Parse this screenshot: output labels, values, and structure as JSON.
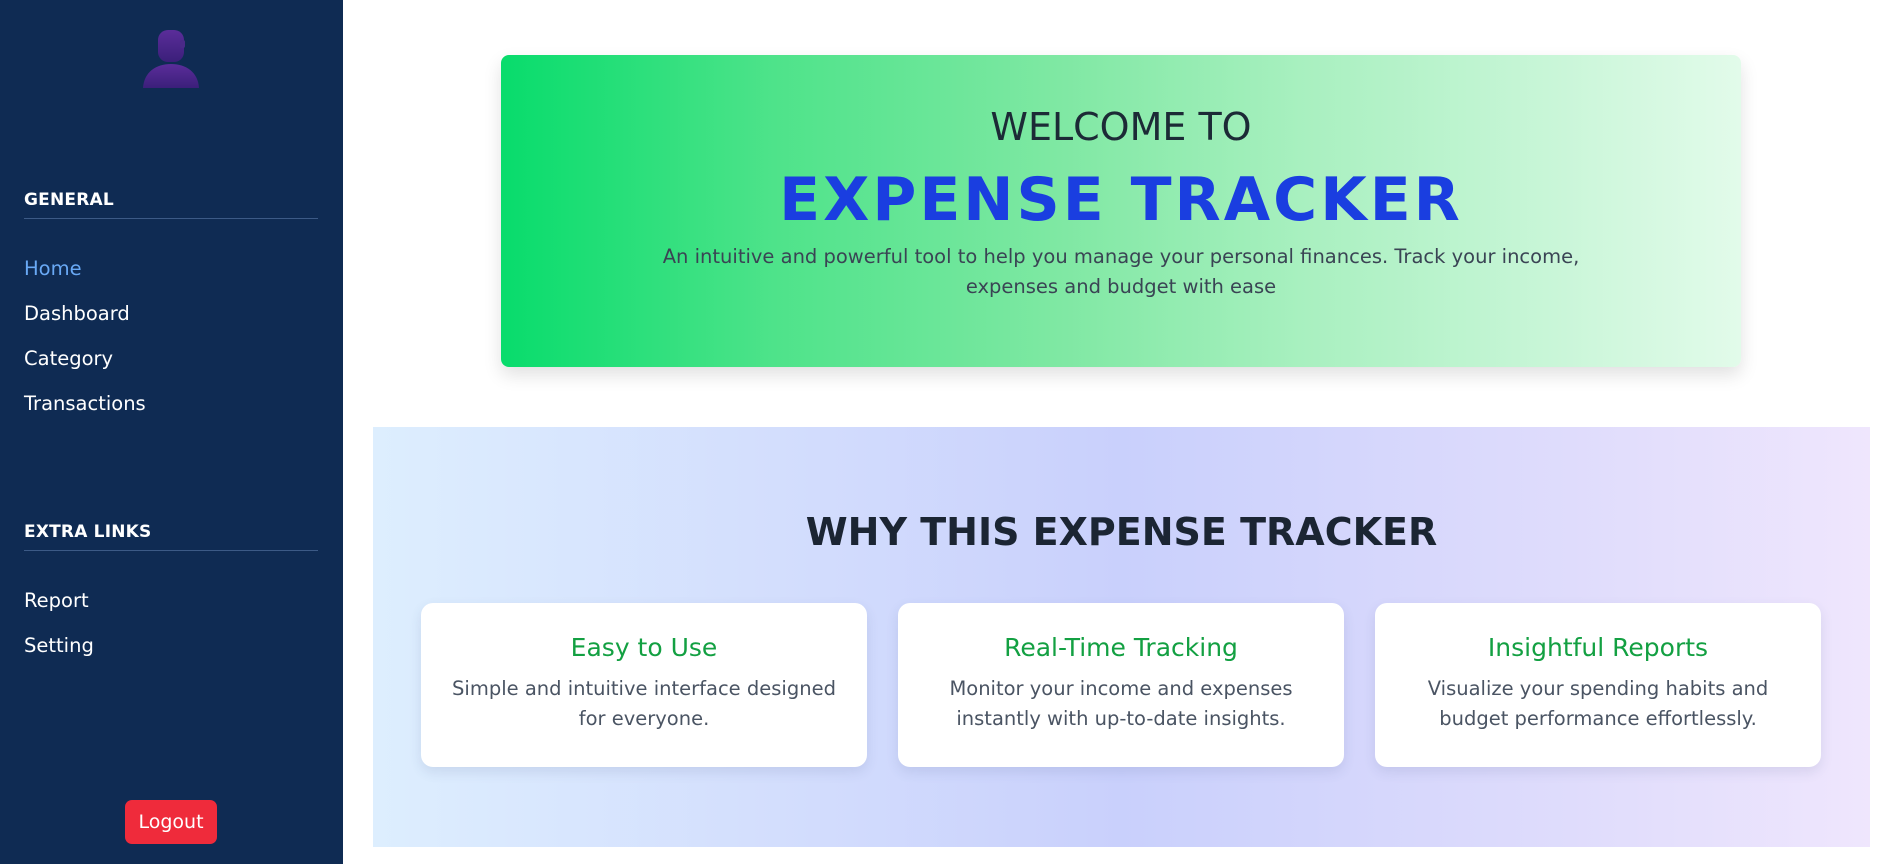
{
  "sidebar": {
    "avatar_icon": "user-avatar-icon",
    "general_title": "GENERAL",
    "general_items": [
      {
        "label": "Home",
        "active": true
      },
      {
        "label": "Dashboard",
        "active": false
      },
      {
        "label": "Category",
        "active": false
      },
      {
        "label": "Transactions",
        "active": false
      }
    ],
    "extra_title": "EXTRA LINKS",
    "extra_items": [
      {
        "label": "Report"
      },
      {
        "label": "Setting"
      }
    ],
    "logout_label": "Logout"
  },
  "hero": {
    "welcome": "WELCOME TO",
    "title": "EXPENSE TRACKER",
    "description": "An intuitive and powerful tool to help you manage your personal finances. Track your income, expenses and budget with ease"
  },
  "why": {
    "title": "WHY THIS EXPENSE TRACKER",
    "cards": [
      {
        "title": "Easy to Use",
        "text": "Simple and intuitive interface designed for everyone."
      },
      {
        "title": "Real-Time Tracking",
        "text": "Monitor your income and expenses instantly with up-to-date insights."
      },
      {
        "title": "Insightful Reports",
        "text": "Visualize your spending habits and budget performance effortlessly."
      }
    ]
  },
  "colors": {
    "sidebar_bg": "#0f2b53",
    "active_link": "#69a9f5",
    "logout_bg": "#ef2b3b",
    "hero_title": "#1a3ee0",
    "card_title": "#13a042"
  }
}
